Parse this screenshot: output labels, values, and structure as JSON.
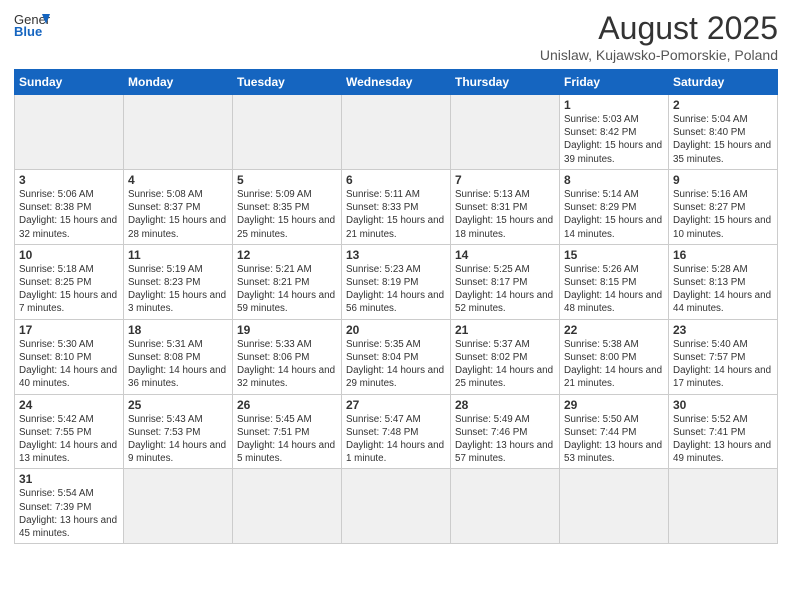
{
  "header": {
    "logo_general": "General",
    "logo_blue": "Blue",
    "month_year": "August 2025",
    "location": "Unislaw, Kujawsko-Pomorskie, Poland"
  },
  "days_of_week": [
    "Sunday",
    "Monday",
    "Tuesday",
    "Wednesday",
    "Thursday",
    "Friday",
    "Saturday"
  ],
  "weeks": [
    [
      {
        "num": "",
        "info": ""
      },
      {
        "num": "",
        "info": ""
      },
      {
        "num": "",
        "info": ""
      },
      {
        "num": "",
        "info": ""
      },
      {
        "num": "",
        "info": ""
      },
      {
        "num": "1",
        "info": "Sunrise: 5:03 AM\nSunset: 8:42 PM\nDaylight: 15 hours and 39 minutes."
      },
      {
        "num": "2",
        "info": "Sunrise: 5:04 AM\nSunset: 8:40 PM\nDaylight: 15 hours and 35 minutes."
      }
    ],
    [
      {
        "num": "3",
        "info": "Sunrise: 5:06 AM\nSunset: 8:38 PM\nDaylight: 15 hours and 32 minutes."
      },
      {
        "num": "4",
        "info": "Sunrise: 5:08 AM\nSunset: 8:37 PM\nDaylight: 15 hours and 28 minutes."
      },
      {
        "num": "5",
        "info": "Sunrise: 5:09 AM\nSunset: 8:35 PM\nDaylight: 15 hours and 25 minutes."
      },
      {
        "num": "6",
        "info": "Sunrise: 5:11 AM\nSunset: 8:33 PM\nDaylight: 15 hours and 21 minutes."
      },
      {
        "num": "7",
        "info": "Sunrise: 5:13 AM\nSunset: 8:31 PM\nDaylight: 15 hours and 18 minutes."
      },
      {
        "num": "8",
        "info": "Sunrise: 5:14 AM\nSunset: 8:29 PM\nDaylight: 15 hours and 14 minutes."
      },
      {
        "num": "9",
        "info": "Sunrise: 5:16 AM\nSunset: 8:27 PM\nDaylight: 15 hours and 10 minutes."
      }
    ],
    [
      {
        "num": "10",
        "info": "Sunrise: 5:18 AM\nSunset: 8:25 PM\nDaylight: 15 hours and 7 minutes."
      },
      {
        "num": "11",
        "info": "Sunrise: 5:19 AM\nSunset: 8:23 PM\nDaylight: 15 hours and 3 minutes."
      },
      {
        "num": "12",
        "info": "Sunrise: 5:21 AM\nSunset: 8:21 PM\nDaylight: 14 hours and 59 minutes."
      },
      {
        "num": "13",
        "info": "Sunrise: 5:23 AM\nSunset: 8:19 PM\nDaylight: 14 hours and 56 minutes."
      },
      {
        "num": "14",
        "info": "Sunrise: 5:25 AM\nSunset: 8:17 PM\nDaylight: 14 hours and 52 minutes."
      },
      {
        "num": "15",
        "info": "Sunrise: 5:26 AM\nSunset: 8:15 PM\nDaylight: 14 hours and 48 minutes."
      },
      {
        "num": "16",
        "info": "Sunrise: 5:28 AM\nSunset: 8:13 PM\nDaylight: 14 hours and 44 minutes."
      }
    ],
    [
      {
        "num": "17",
        "info": "Sunrise: 5:30 AM\nSunset: 8:10 PM\nDaylight: 14 hours and 40 minutes."
      },
      {
        "num": "18",
        "info": "Sunrise: 5:31 AM\nSunset: 8:08 PM\nDaylight: 14 hours and 36 minutes."
      },
      {
        "num": "19",
        "info": "Sunrise: 5:33 AM\nSunset: 8:06 PM\nDaylight: 14 hours and 32 minutes."
      },
      {
        "num": "20",
        "info": "Sunrise: 5:35 AM\nSunset: 8:04 PM\nDaylight: 14 hours and 29 minutes."
      },
      {
        "num": "21",
        "info": "Sunrise: 5:37 AM\nSunset: 8:02 PM\nDaylight: 14 hours and 25 minutes."
      },
      {
        "num": "22",
        "info": "Sunrise: 5:38 AM\nSunset: 8:00 PM\nDaylight: 14 hours and 21 minutes."
      },
      {
        "num": "23",
        "info": "Sunrise: 5:40 AM\nSunset: 7:57 PM\nDaylight: 14 hours and 17 minutes."
      }
    ],
    [
      {
        "num": "24",
        "info": "Sunrise: 5:42 AM\nSunset: 7:55 PM\nDaylight: 14 hours and 13 minutes."
      },
      {
        "num": "25",
        "info": "Sunrise: 5:43 AM\nSunset: 7:53 PM\nDaylight: 14 hours and 9 minutes."
      },
      {
        "num": "26",
        "info": "Sunrise: 5:45 AM\nSunset: 7:51 PM\nDaylight: 14 hours and 5 minutes."
      },
      {
        "num": "27",
        "info": "Sunrise: 5:47 AM\nSunset: 7:48 PM\nDaylight: 14 hours and 1 minute."
      },
      {
        "num": "28",
        "info": "Sunrise: 5:49 AM\nSunset: 7:46 PM\nDaylight: 13 hours and 57 minutes."
      },
      {
        "num": "29",
        "info": "Sunrise: 5:50 AM\nSunset: 7:44 PM\nDaylight: 13 hours and 53 minutes."
      },
      {
        "num": "30",
        "info": "Sunrise: 5:52 AM\nSunset: 7:41 PM\nDaylight: 13 hours and 49 minutes."
      }
    ],
    [
      {
        "num": "31",
        "info": "Sunrise: 5:54 AM\nSunset: 7:39 PM\nDaylight: 13 hours and 45 minutes."
      },
      {
        "num": "",
        "info": ""
      },
      {
        "num": "",
        "info": ""
      },
      {
        "num": "",
        "info": ""
      },
      {
        "num": "",
        "info": ""
      },
      {
        "num": "",
        "info": ""
      },
      {
        "num": "",
        "info": ""
      }
    ]
  ]
}
